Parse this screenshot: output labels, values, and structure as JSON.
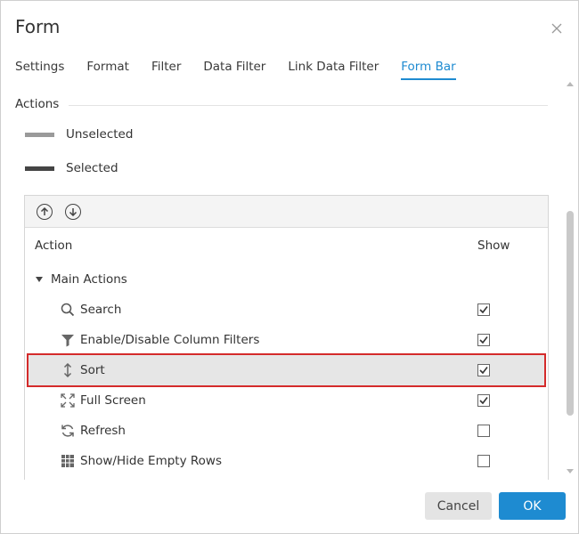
{
  "dialog": {
    "title": "Form"
  },
  "tabs": [
    {
      "label": "Settings"
    },
    {
      "label": "Format"
    },
    {
      "label": "Filter"
    },
    {
      "label": "Data Filter"
    },
    {
      "label": "Link Data Filter"
    },
    {
      "label": "Form Bar",
      "active": true
    }
  ],
  "actions_section": {
    "title": "Actions",
    "legend": [
      {
        "label": "Unselected",
        "color": "#9a9a9a"
      },
      {
        "label": "Selected",
        "color": "#444444"
      }
    ]
  },
  "table": {
    "headers": {
      "action": "Action",
      "show": "Show"
    },
    "group": {
      "label": "Main Actions"
    },
    "items": [
      {
        "label": "Search",
        "icon": "search-icon",
        "checked": true
      },
      {
        "label": "Enable/Disable Column Filters",
        "icon": "filter-icon",
        "checked": true
      },
      {
        "label": "Sort",
        "icon": "sort-icon",
        "checked": true,
        "highlighted": true
      },
      {
        "label": "Full Screen",
        "icon": "fullscreen-icon",
        "checked": true
      },
      {
        "label": "Refresh",
        "icon": "refresh-icon",
        "checked": false
      },
      {
        "label": "Show/Hide Empty Rows",
        "icon": "grid-icon",
        "checked": false
      }
    ]
  },
  "footer": {
    "cancel_label": "Cancel",
    "ok_label": "OK"
  },
  "colors": {
    "accent": "#1e8bd1",
    "highlight_border": "#d42b2b"
  }
}
